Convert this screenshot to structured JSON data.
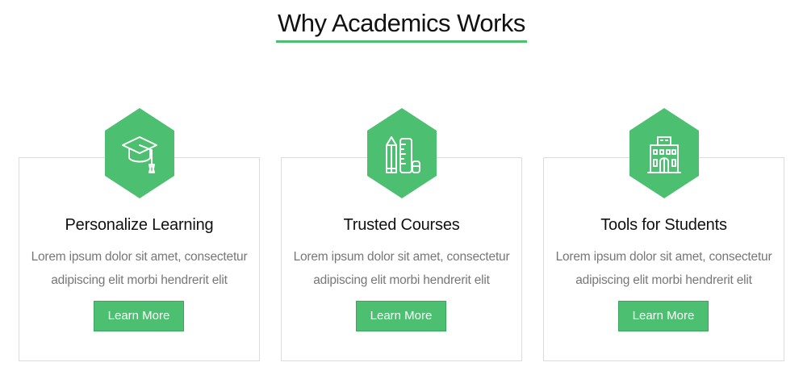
{
  "section": {
    "title": "Why Academics Works"
  },
  "colors": {
    "accent": "#4cbf70",
    "card_border": "#dcdcdc",
    "body_text": "#777777"
  },
  "features": [
    {
      "icon": "graduation-cap-icon",
      "title": "Personalize Learning",
      "text": "Lorem ipsum dolor sit amet, consectetur adipiscing elit morbi hendrerit elit",
      "button": "Learn More"
    },
    {
      "icon": "pencil-ruler-icon",
      "title": "Trusted Courses",
      "text": "Lorem ipsum dolor sit amet, consectetur adipiscing elit morbi hendrerit elit",
      "button": "Learn More"
    },
    {
      "icon": "school-building-icon",
      "title": "Tools for Students",
      "text": "Lorem ipsum dolor sit amet, consectetur adipiscing elit morbi hendrerit elit",
      "button": "Learn More"
    }
  ]
}
